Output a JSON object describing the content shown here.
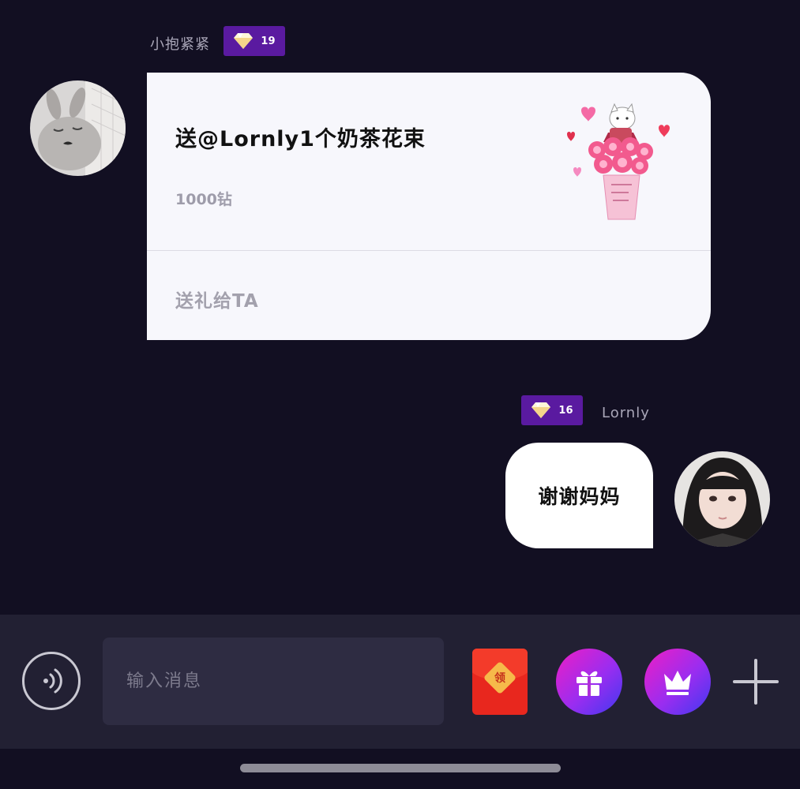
{
  "messages": {
    "incoming": {
      "sender_name": "小抱紧紧",
      "level": "19",
      "gift_card": {
        "title": "送@Lornly1个奶茶花束",
        "price": "1000钻",
        "action_label": "送礼给TA"
      }
    },
    "outgoing": {
      "sender_name": "Lornly",
      "level": "16",
      "text": "谢谢妈妈"
    }
  },
  "input_bar": {
    "placeholder": "输入消息",
    "red_packet_label": "领",
    "icons": [
      "voice-icon",
      "red-packet-icon",
      "gift-icon",
      "crown-icon",
      "plus-icon"
    ]
  },
  "colors": {
    "background": "#120f22",
    "level_badge": "#5a1aa0",
    "input_bar": "#222033",
    "gift_card_bg": "#f7f7fc",
    "round_button_gradient": [
      "#ee1ec4",
      "#9a2df0",
      "#3f39f0"
    ]
  }
}
